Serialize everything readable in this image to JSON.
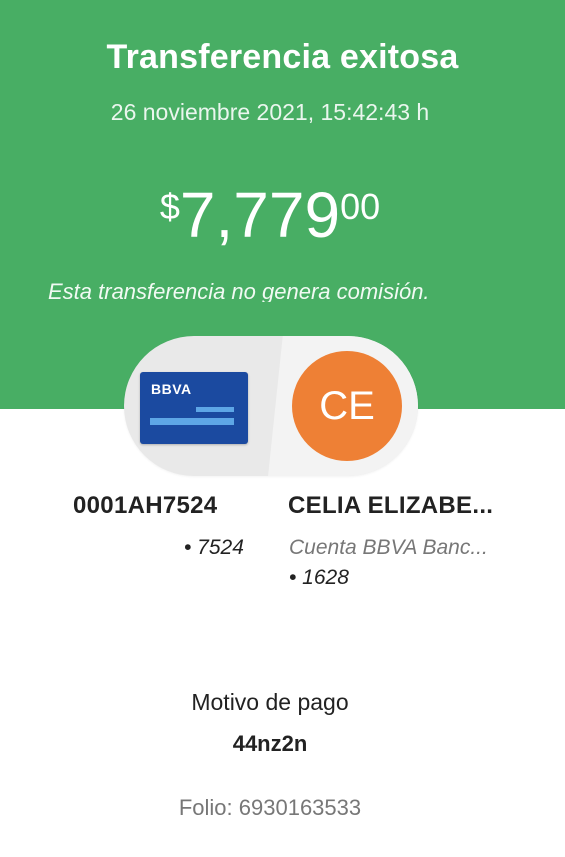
{
  "header": {
    "title": "Transferencia exitosa",
    "datetime": "26 noviembre 2021, 15:42:43 h",
    "commission_note": "Esta transferencia no genera comisión."
  },
  "amount": {
    "currency_symbol": "$",
    "integer": "7,779",
    "decimals": "00"
  },
  "origin": {
    "card_brand": "BBVA",
    "account_name": "0001AH7524",
    "account_digits": "• 7524"
  },
  "destination": {
    "initials": "CE",
    "name": "CELIA ELIZABE...",
    "bank": "Cuenta BBVA Banc...",
    "account_digits": "• 1628"
  },
  "payment": {
    "motivo_label": "Motivo de pago",
    "motivo_value": "44nz2n",
    "folio": "Folio: 6930163533"
  },
  "colors": {
    "header_green": "#48ae64",
    "avatar_orange": "#ee8035",
    "card_blue": "#1b4aa0"
  }
}
